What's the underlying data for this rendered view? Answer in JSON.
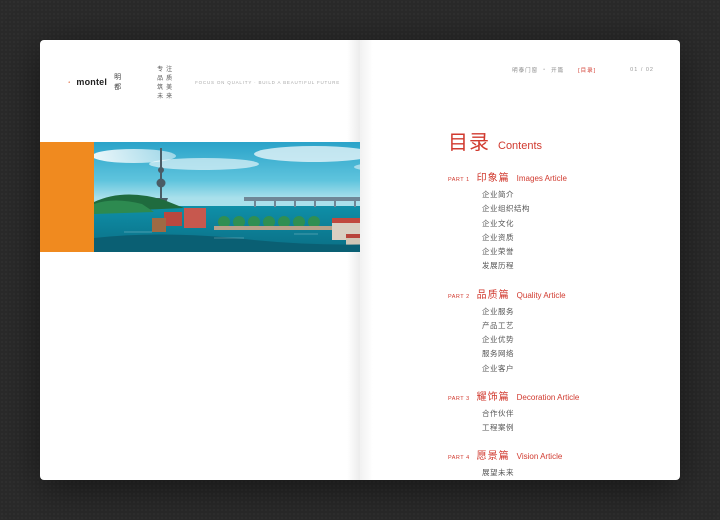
{
  "brand": {
    "wordmark": "montel",
    "cn_name": "明都",
    "tagline_cn": "专注品质　筑美未来",
    "tagline_en": "FOCUS ON QUALITY · BUILD A BEAUTIFUL FUTURE"
  },
  "header_right": {
    "crumb1": "明泰门窗",
    "crumb2": "开篇",
    "section_label": "[目录]",
    "page_label": "01 / 02"
  },
  "colors": {
    "accent_red": "#d13a2f",
    "accent_orange": "#f08a1f"
  },
  "toc": {
    "title_cn": "目录",
    "title_en": "Contents",
    "parts": [
      {
        "tag": "PART 1",
        "cn": "印象篇",
        "en": "Images Article",
        "items": [
          "企业简介",
          "企业组织结构",
          "企业文化",
          "企业资质",
          "企业荣誉",
          "发展历程"
        ]
      },
      {
        "tag": "PART 2",
        "cn": "品质篇",
        "en": "Quality Article",
        "items": [
          "企业服务",
          "产品工艺",
          "企业优势",
          "服务网络",
          "企业客户"
        ]
      },
      {
        "tag": "PART 3",
        "cn": "耀饰篇",
        "en": "Decoration Article",
        "items": [
          "合作伙伴",
          "工程案例"
        ]
      },
      {
        "tag": "PART 4",
        "cn": "愿景篇",
        "en": "Vision Article",
        "items": [
          "展望未来"
        ]
      }
    ]
  }
}
